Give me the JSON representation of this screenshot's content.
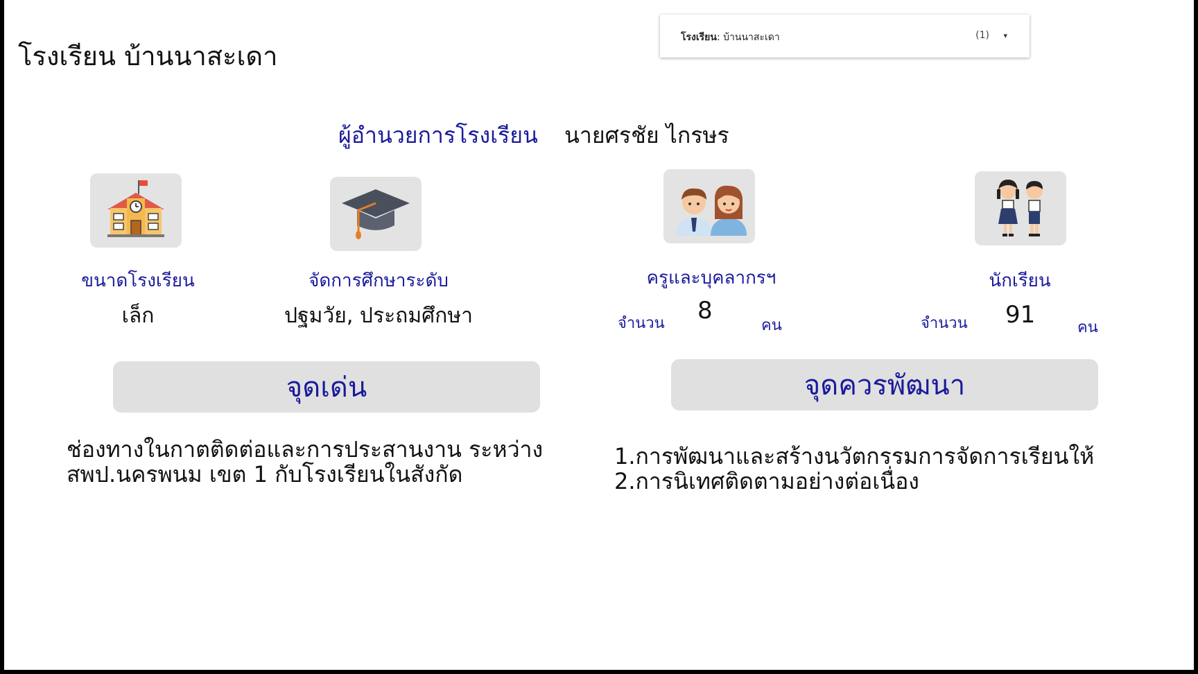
{
  "page_title": "โรงเรียน บ้านนาสะเดา",
  "filter": {
    "label": "โรงเรียน",
    "value": "บ้านนาสะเดา",
    "count": "(1)",
    "caret": "▾"
  },
  "director": {
    "label": "ผู้อำนวยการโรงเรียน",
    "name": "นายศรชัย ไกรษร"
  },
  "cards": {
    "school_size": {
      "label": "ขนาดโรงเรียน",
      "value": "เล็ก"
    },
    "education_level": {
      "label": "จัดการศึกษาระดับ",
      "value": "ปฐมวัย, ประถมศึกษา"
    },
    "staff": {
      "label": "ครูและบุคลากรฯ",
      "count_label": "จำนวน",
      "count": "8",
      "unit": "คน"
    },
    "students": {
      "label": "นักเรียน",
      "count_label": "จำนวน",
      "count": "91",
      "unit": "คน"
    }
  },
  "strengths": {
    "title": "จุดเด่น",
    "lines": [
      "ช่องทางในกาตติดต่อและการประสานงาน ระหว่าง",
      "สพป.นครพนม เขต 1 กับโรงเรียนในสังกัด"
    ]
  },
  "improvements": {
    "title": "จุดควรพัฒนา",
    "lines": [
      "1.การพัฒนาและสร้างนวัตกรรมการจัดการเรียนให้",
      "2.การนิเทศติดตามอย่างต่อเนื่อง"
    ]
  },
  "icons": {
    "school": "school-building-icon",
    "graduation": "graduation-cap-icon",
    "teachers": "teachers-icon",
    "students": "students-icon"
  },
  "colors": {
    "accent_blue": "#1a1a9c",
    "box_gray": "#e0e0e0"
  }
}
